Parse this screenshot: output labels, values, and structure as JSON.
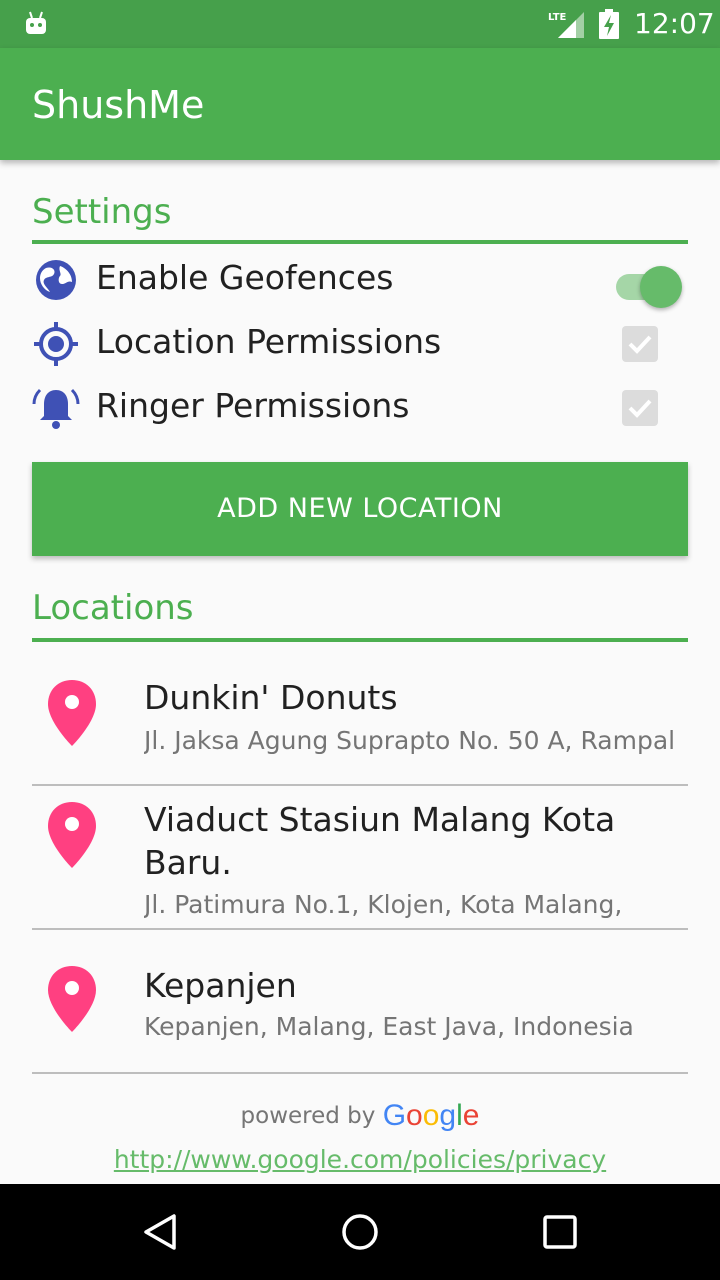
{
  "status_bar": {
    "time": "12:07",
    "network": "LTE",
    "icons": [
      "android-icon",
      "lte-signal-icon",
      "battery-charging-icon"
    ]
  },
  "app_bar": {
    "title": "ShushMe"
  },
  "settings": {
    "title": "Settings",
    "items": [
      {
        "label": "Enable Geofences",
        "icon": "globe-icon",
        "control": "switch",
        "checked": true
      },
      {
        "label": "Location Permissions",
        "icon": "gps-target-icon",
        "control": "checkbox",
        "checked": true
      },
      {
        "label": "Ringer Permissions",
        "icon": "bell-ringing-icon",
        "control": "checkbox",
        "checked": true
      }
    ]
  },
  "add_button": {
    "label": "ADD NEW LOCATION"
  },
  "locations": {
    "title": "Locations",
    "items": [
      {
        "name": "Dunkin' Donuts",
        "address": "Jl. Jaksa Agung Suprapto No. 50 A, Rampal"
      },
      {
        "name": "Viaduct Stasiun Malang Kota Baru.",
        "address": "Jl. Patimura No.1, Klojen, Kota Malang,"
      },
      {
        "name": "Kepanjen",
        "address": "Kepanjen, Malang, East Java, Indonesia"
      }
    ]
  },
  "footer": {
    "powered_by": "powered by",
    "google": [
      "G",
      "o",
      "o",
      "g",
      "l",
      "e"
    ],
    "privacy_url": "http://www.google.com/policies/privacy"
  },
  "colors": {
    "primary": "#4caf50",
    "primary_dark": "#46a04b",
    "icon_indigo": "#3f51b5",
    "pin": "#ff4081",
    "google_blue": "#4285f4",
    "google_red": "#ea4335",
    "google_yellow": "#fbbc05",
    "google_green": "#34a853"
  },
  "nav_bar": {
    "buttons": [
      "back-icon",
      "home-icon",
      "recents-icon"
    ]
  }
}
